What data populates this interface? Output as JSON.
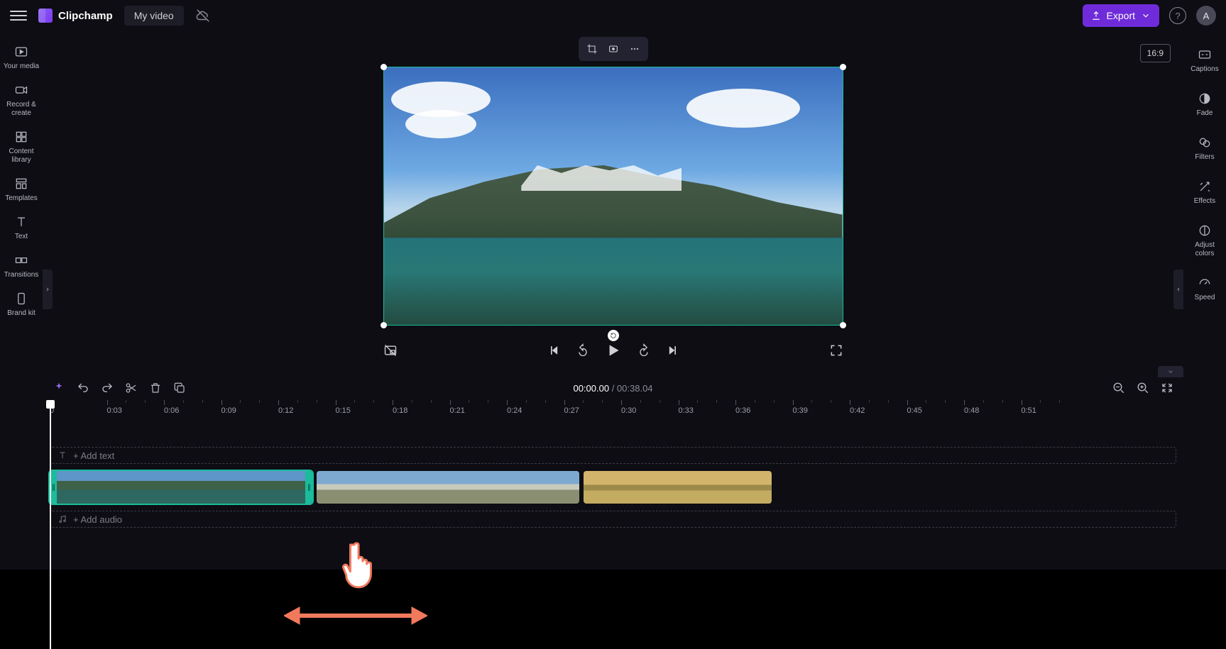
{
  "header": {
    "app_name": "Clipchamp",
    "project_title": "My video",
    "export_label": "Export",
    "help_glyph": "?",
    "avatar_initial": "A",
    "aspect_ratio": "16:9"
  },
  "left_rail": {
    "items": [
      {
        "id": "your-media",
        "label": "Your media"
      },
      {
        "id": "record-create",
        "label": "Record & create"
      },
      {
        "id": "content-library",
        "label": "Content library"
      },
      {
        "id": "templates",
        "label": "Templates"
      },
      {
        "id": "text",
        "label": "Text"
      },
      {
        "id": "transitions",
        "label": "Transitions"
      },
      {
        "id": "brand-kit",
        "label": "Brand kit"
      }
    ]
  },
  "right_rail": {
    "items": [
      {
        "id": "captions",
        "label": "Captions"
      },
      {
        "id": "fade",
        "label": "Fade"
      },
      {
        "id": "filters",
        "label": "Filters"
      },
      {
        "id": "effects",
        "label": "Effects"
      },
      {
        "id": "adjust-colors",
        "label": "Adjust colors"
      },
      {
        "id": "speed",
        "label": "Speed"
      }
    ]
  },
  "timeline": {
    "current_time": "00:00.00",
    "separator": " / ",
    "total_time": "00:38.04",
    "ruler_start_label": "0",
    "ticks": [
      "0:03",
      "0:06",
      "0:09",
      "0:12",
      "0:15",
      "0:18",
      "0:21",
      "0:24",
      "0:27",
      "0:30",
      "0:33",
      "0:36",
      "0:39",
      "0:42",
      "0:45",
      "0:48",
      "0:51"
    ],
    "text_lane_placeholder": "+ Add text",
    "audio_lane_placeholder": "+ Add audio",
    "clips": [
      {
        "id": "clip1",
        "selected": true,
        "frames": 8
      },
      {
        "id": "clip2",
        "selected": false,
        "frames": 8
      },
      {
        "id": "clip3",
        "selected": false,
        "frames": 6
      }
    ]
  }
}
